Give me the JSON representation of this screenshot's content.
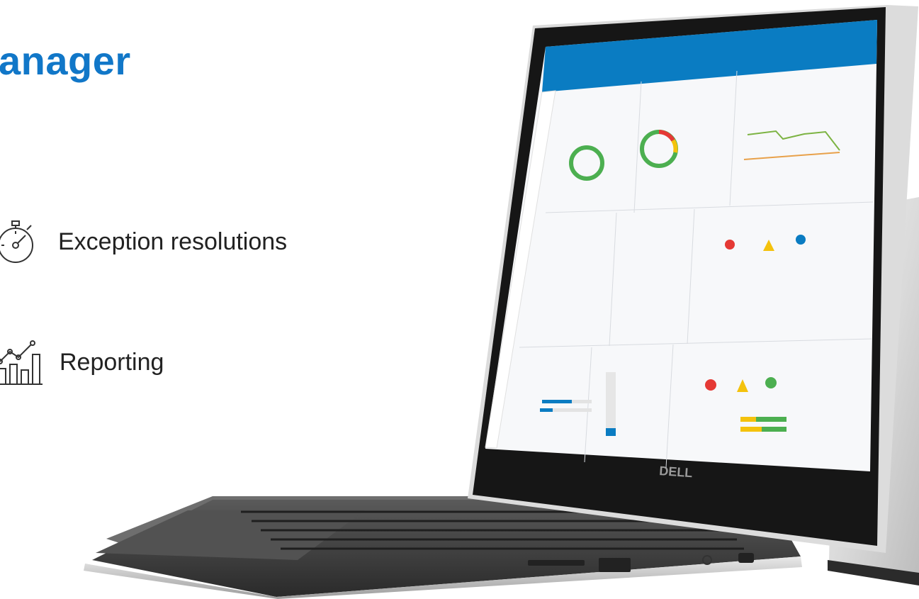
{
  "title": "anager",
  "features": [
    {
      "label": "Exception resolutions",
      "icon": "stopwatch-icon"
    },
    {
      "label": "Reporting",
      "icon": "line-chart-icon"
    }
  ],
  "device": {
    "brand_logo": "DELL",
    "screen": "dashboard-screenshot"
  },
  "colors": {
    "title": "#1177c8",
    "accent": "#0a7cc2",
    "status_green": "#4caf50",
    "status_red": "#e53935",
    "status_yellow": "#f4c20d"
  }
}
